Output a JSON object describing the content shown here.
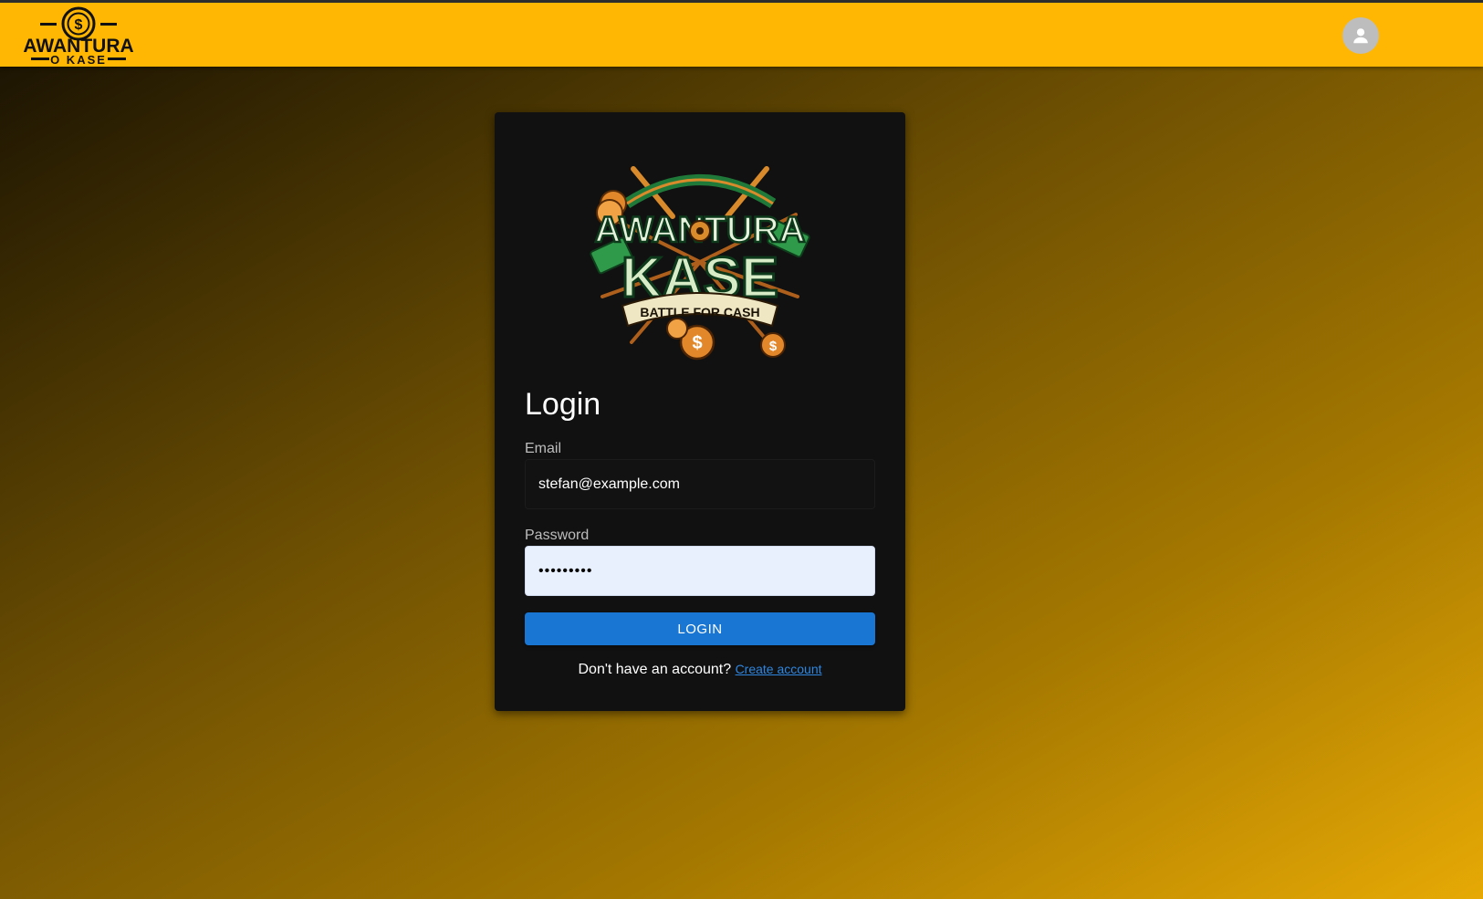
{
  "header": {
    "logo_line1": "AWANTURA",
    "logo_line2": "O KASE",
    "logo_symbol": "$",
    "profile_icon": "person-icon",
    "bar_color": "#ffb703"
  },
  "login": {
    "emblem_line1": "AWANTURA",
    "emblem_line2": "KASE",
    "emblem_banner": "BATTLE FOR CASH",
    "title": "Login",
    "email_label": "Email",
    "email_value": "stefan@example.com",
    "password_label": "Password",
    "password_value": "•••••••••",
    "submit_label": "LOGIN",
    "footer_text": "Don't have an account?",
    "create_account_label": "Create account",
    "accent_color": "#1976d2"
  }
}
